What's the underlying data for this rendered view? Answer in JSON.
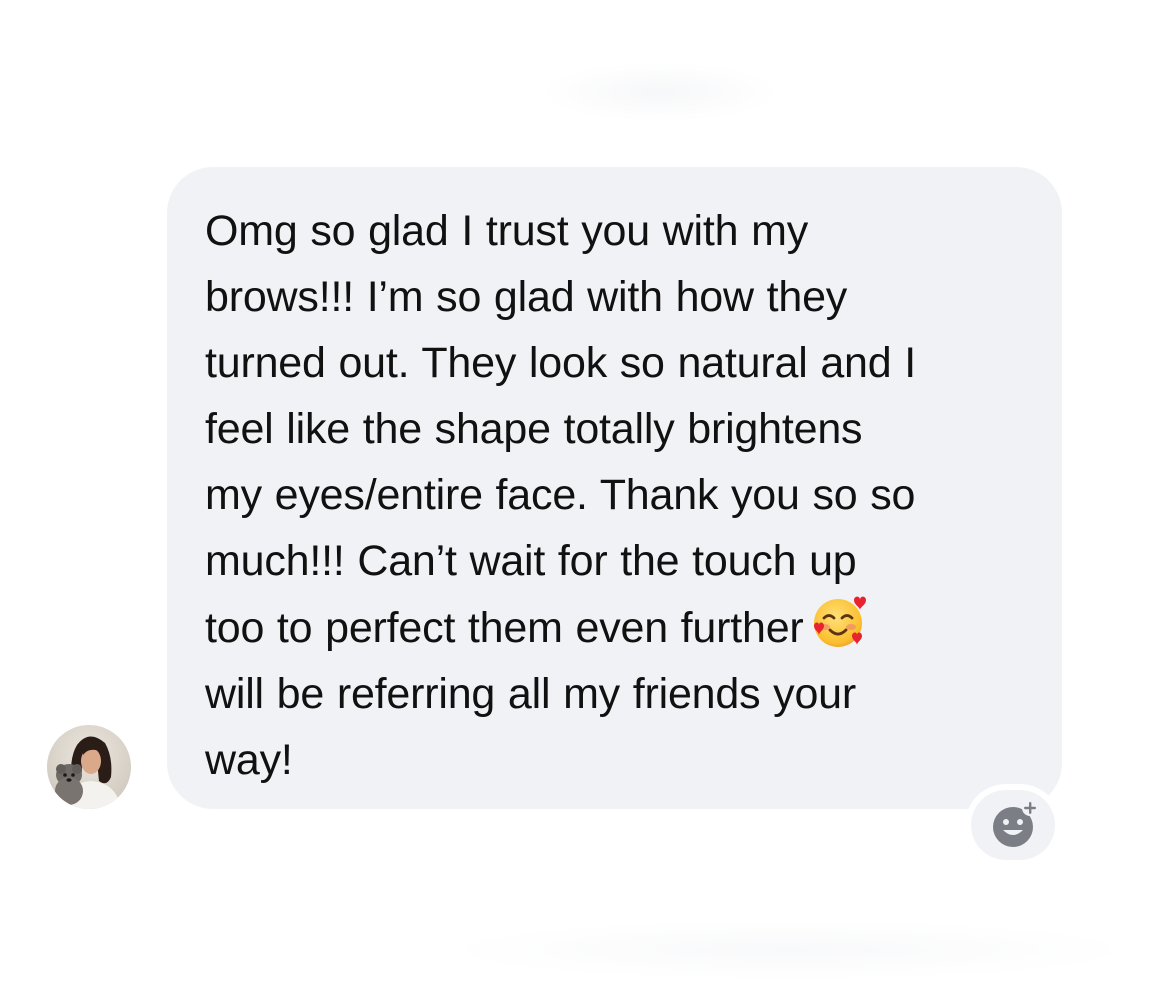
{
  "conversation": {
    "message": {
      "lines": [
        "Omg so glad I trust you with my",
        "brows!!! I’m so glad with how they",
        "turned out. They look so natural and I",
        "feel like the shape totally brightens",
        "my eyes/entire face. Thank you so so",
        "much!!! Can’t wait for the touch up",
        "too to perfect them even further",
        "will be referring all my friends your",
        "way!"
      ],
      "inline_emoji": "smiling-face-with-hearts-emoji"
    },
    "sender_avatar": "profile-avatar",
    "reaction_icon": "add-reaction-icon"
  },
  "colors": {
    "bubble_background": "#f1f2f6",
    "text": "#111111",
    "reaction_icon": "#7b7e85"
  }
}
